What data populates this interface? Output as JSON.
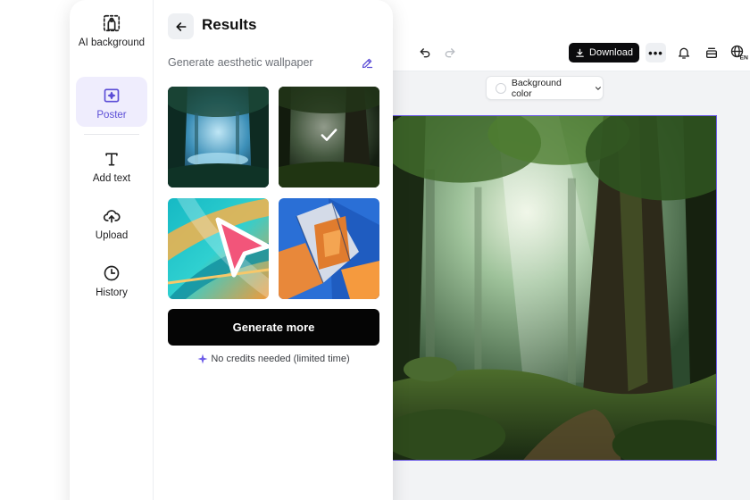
{
  "sidebar": {
    "items": [
      {
        "label": "AI background",
        "icon": "ai-background-icon"
      },
      {
        "label": "Poster",
        "icon": "poster-icon",
        "active": true
      },
      {
        "label": "Add text",
        "icon": "text-icon"
      },
      {
        "label": "Upload",
        "icon": "cloud-upload-icon"
      },
      {
        "label": "History",
        "icon": "clock-icon"
      }
    ]
  },
  "results": {
    "title": "Results",
    "prompt": "Generate aesthetic wallpaper",
    "generate_label": "Generate more",
    "credits_note": "No credits needed (limited time)",
    "selected_index": 1
  },
  "toolbar": {
    "download_label": "Download",
    "more_label": "•••"
  },
  "canvas": {
    "bg_color_label": "Background color"
  },
  "colors": {
    "accent": "#6d5ce8",
    "active_bg": "#efedfd",
    "cursor": "#f2557a",
    "primary_button": "#050505"
  }
}
